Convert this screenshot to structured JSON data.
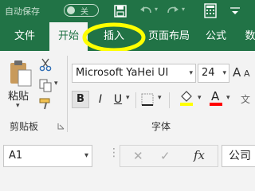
{
  "titlebar": {
    "autosave_label": "自动保存",
    "autosave_state": "关"
  },
  "tabs": [
    {
      "label": "文件"
    },
    {
      "label": "开始"
    },
    {
      "label": "插入"
    },
    {
      "label": "页面布局"
    },
    {
      "label": "公式"
    },
    {
      "label": "数"
    }
  ],
  "ribbon": {
    "clipboard": {
      "paste_label": "粘贴",
      "group_label": "剪贴板"
    },
    "font": {
      "font_name": "Microsoft YaHei UI",
      "font_size": "24",
      "group_label": "字体",
      "bold": "B",
      "italic": "I",
      "underline": "U",
      "font_color_letter": "A",
      "grow_font": "A",
      "shrink_font": "A"
    },
    "colors": {
      "accent": "#217346",
      "highlight": "#ffff00",
      "font_color": "#ff0000",
      "annotation_ring": "#ffff00"
    }
  },
  "formula_bar": {
    "name_box": "A1",
    "fx_label": "fx",
    "formula_value": "公司"
  }
}
